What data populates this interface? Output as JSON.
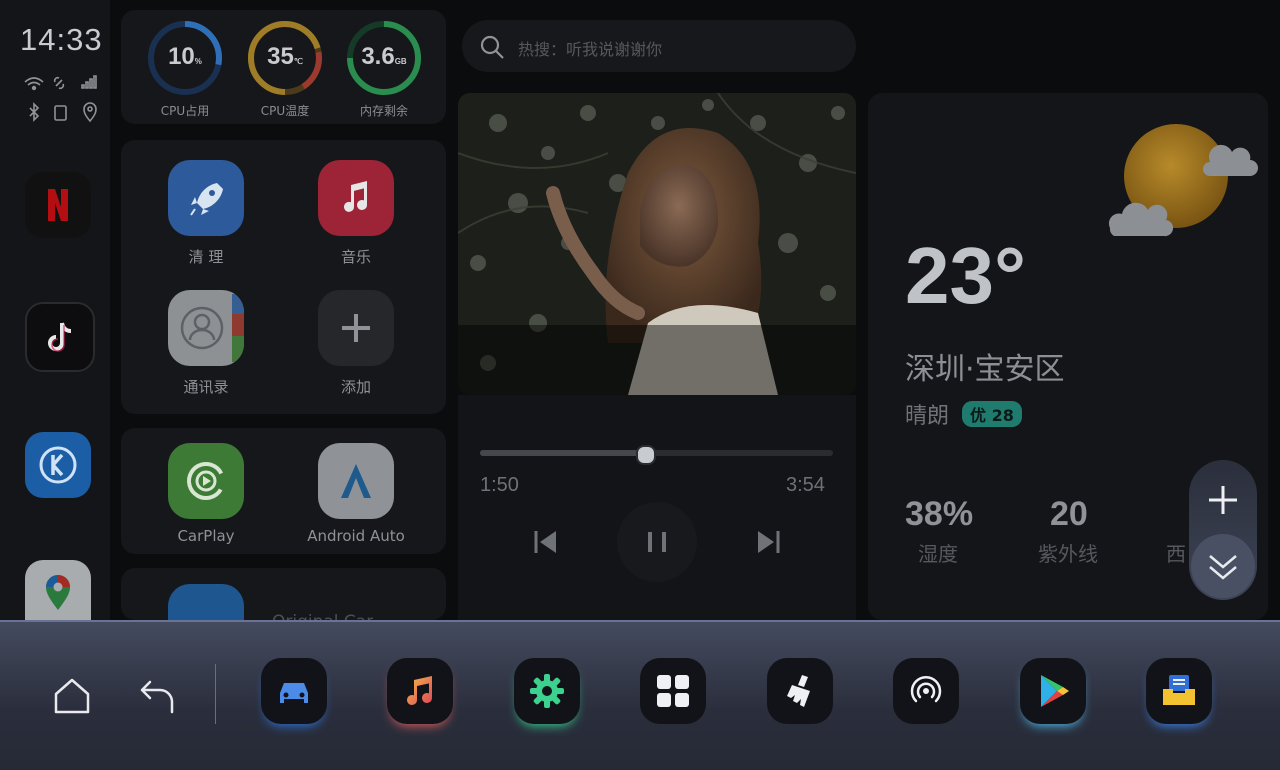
{
  "status": {
    "time": "14:33"
  },
  "system": {
    "cpu": {
      "value": "10",
      "unit": "%",
      "label": "CPU占用"
    },
    "temp": {
      "value": "35",
      "unit": "℃",
      "label": "CPU温度"
    },
    "mem": {
      "value": "3.6",
      "unit": "GB",
      "label": "内存剩余"
    }
  },
  "apps": {
    "clean": "清 理",
    "music": "音乐",
    "contacts": "通讯录",
    "add": "添加",
    "carplay": "CarPlay",
    "androidauto": "Android Auto",
    "original": "Original Car"
  },
  "search": {
    "placeholder": "热搜：听我说谢谢你"
  },
  "player": {
    "elapsed": "1:50",
    "duration": "3:54",
    "progress": 0.47
  },
  "weather": {
    "temp": "23°",
    "city": "深圳·宝安区",
    "condition": "晴朗",
    "aqi": "优 28",
    "humidity_value": "38%",
    "humidity_label": "湿度",
    "uv_value": "20",
    "uv_label": "紫外线",
    "wind_label": "西"
  },
  "colors": {
    "accent": "#4d8be8",
    "aqi": "#1f7b6e",
    "bar_top": "#6a7396"
  }
}
